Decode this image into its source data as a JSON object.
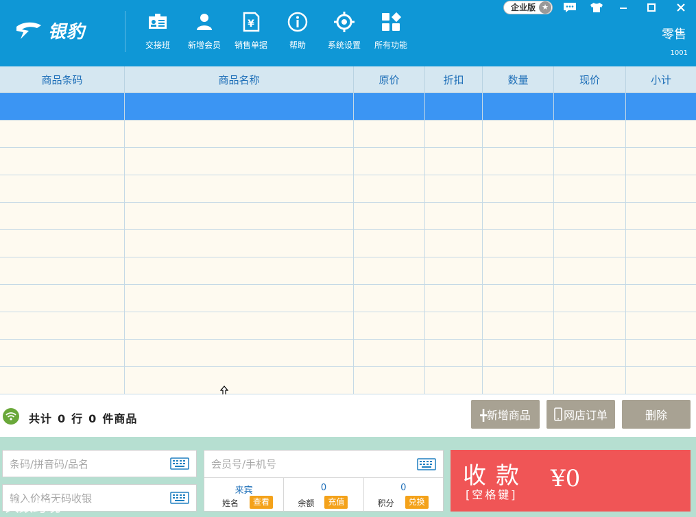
{
  "header": {
    "logo_text": "银豹",
    "edition_badge": "企业版",
    "mode": "零售",
    "store_no": "1001",
    "nav": [
      {
        "label": "交接班",
        "icon": "shift-handover-icon"
      },
      {
        "label": "新增会员",
        "icon": "add-member-icon"
      },
      {
        "label": "销售单据",
        "icon": "sales-receipt-icon"
      },
      {
        "label": "帮助",
        "icon": "help-icon"
      },
      {
        "label": "系统设置",
        "icon": "settings-icon"
      },
      {
        "label": "所有功能",
        "icon": "all-functions-icon"
      }
    ]
  },
  "table": {
    "columns": [
      "商品条码",
      "商品名称",
      "原价",
      "折扣",
      "数量",
      "现价",
      "小计"
    ],
    "row_count": 11,
    "selected_row": 0
  },
  "summary": {
    "prefix": "共计",
    "rows": "0",
    "rows_unit": "行",
    "items": "0",
    "items_unit": "件商品"
  },
  "actions": {
    "add_product": "╋新增商品",
    "online_order": "网店订单",
    "delete": "删除"
  },
  "inputs": {
    "barcode_placeholder": "条码/拼音码/品名",
    "price_placeholder": "输入价格无码收银",
    "member_placeholder": "会员号/手机号"
  },
  "member": {
    "name_value": "来宾",
    "name_label": "姓名",
    "view_button": "查看",
    "balance_value": "0",
    "balance_label": "余额",
    "recharge_button": "充值",
    "points_value": "0",
    "points_label": "积分",
    "redeem_button": "兑换"
  },
  "pay": {
    "title": "收款",
    "hint": "[空格键]",
    "amount": "¥0"
  },
  "watermark": "大数跨境",
  "colors": {
    "header_bg": "#0f97d6",
    "selected_row": "#3b95f3",
    "pay_bg": "#f05556",
    "bottom_bg": "#b6dfd1",
    "action_btn": "#a8a293",
    "orange_btn": "#f4a21a"
  }
}
